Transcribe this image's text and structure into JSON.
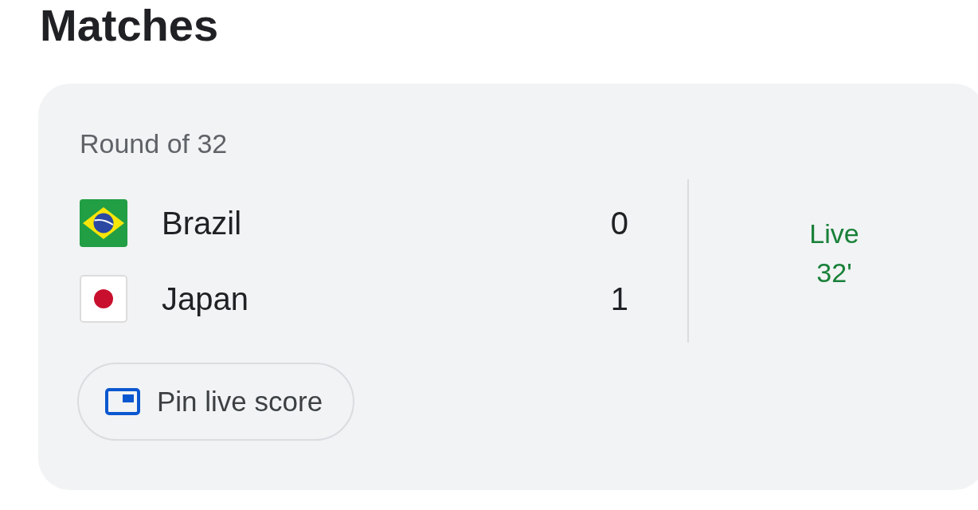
{
  "title": "Matches",
  "match": {
    "stage": "Round of 32",
    "teams": [
      {
        "name": "Brazil",
        "score": "0",
        "kind": "brazil"
      },
      {
        "name": "Japan",
        "score": "1",
        "kind": "japan"
      }
    ],
    "status": {
      "label": "Live",
      "minute": "32'"
    },
    "pin_button": {
      "label": "Pin live score"
    }
  }
}
